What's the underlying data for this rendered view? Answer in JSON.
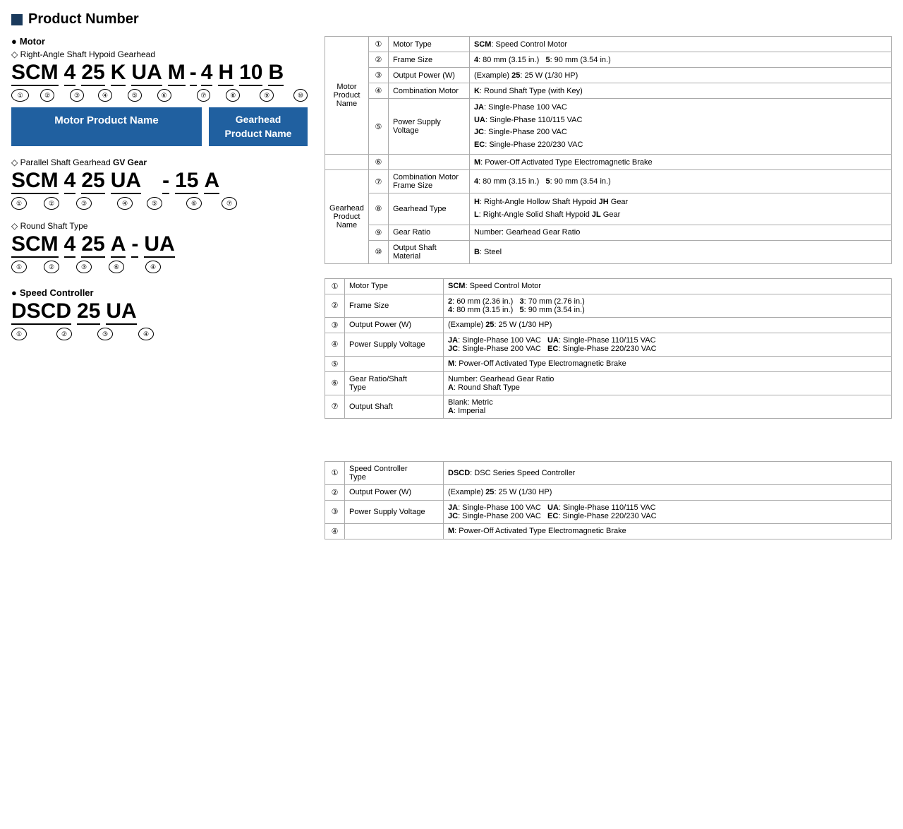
{
  "page": {
    "title": "Product Number",
    "sections": {
      "motor": {
        "label": "Motor",
        "subsections": [
          {
            "type": "diamond",
            "label": "Right-Angle Shaft Hypoid Gearhead",
            "code_parts": [
              "SCM",
              "4",
              "25",
              "K",
              "UA",
              "M",
              "-",
              "4",
              "H",
              "10",
              "B"
            ],
            "nums": [
              "①",
              "②",
              "③",
              "④",
              "⑤",
              "⑥",
              "",
              "⑦",
              "⑧",
              "⑨",
              "⑩"
            ],
            "blue_boxes": [
              "Motor Product Name",
              "Gearhead\nProduct Name"
            ],
            "table_rows": [
              {
                "group": "Motor\nProduct\nName",
                "num": "①",
                "field": "Motor Type",
                "desc": "<b>SCM</b>: Speed Control Motor"
              },
              {
                "group": "",
                "num": "②",
                "field": "Frame Size",
                "desc": "<b>4</b>: 80 mm (3.15 in.)   <b>5</b>: 90 mm (3.54 in.)"
              },
              {
                "group": "",
                "num": "③",
                "field": "Output Power (W)",
                "desc": "(Example) <b>25</b>: 25 W (1/30 HP)"
              },
              {
                "group": "",
                "num": "④",
                "field": "Combination Motor",
                "desc": "<b>K</b>: Round Shaft Type (with Key)"
              },
              {
                "group": "",
                "num": "⑤",
                "field": "Power Supply Voltage",
                "desc": "<b>JA</b>: Single-Phase 100 VAC\n<b>UA</b>: Single-Phase 110/115 VAC\n<b>JC</b>: Single-Phase 200 VAC\n<b>EC</b>: Single-Phase 220/230 VAC"
              },
              {
                "group": "",
                "num": "⑥",
                "field": "",
                "desc": "<b>M</b>: Power-Off Activated Type Electromagnetic Brake"
              },
              {
                "group": "Gearhead\nProduct\nName",
                "num": "⑦",
                "field": "Combination Motor\nFrame Size",
                "desc": "<b>4</b>: 80 mm (3.15 in.)   <b>5</b>: 90 mm (3.54 in.)"
              },
              {
                "group": "",
                "num": "⑧",
                "field": "Gearhead Type",
                "desc": "<b>H</b>: Right-Angle Hollow Shaft Hypoid <b>JH</b> Gear\n<b>L</b>: Right-Angle Solid Shaft Hypoid <b>JL</b> Gear"
              },
              {
                "group": "",
                "num": "⑨",
                "field": "Gear Ratio",
                "desc": "Number: Gearhead Gear Ratio"
              },
              {
                "group": "",
                "num": "⑩",
                "field": "Output Shaft Material",
                "desc": "<b>B</b>: Steel"
              }
            ]
          },
          {
            "type": "diamond",
            "label": "Parallel Shaft Gearhead GV Gear",
            "label_bold": "GV Gear",
            "code_display": "SCM 4 25 UA   - 15 A",
            "nums_display": "① ② ③ ④ ⑤  ⑥ ⑦",
            "table_rows2": [
              {
                "num": "①",
                "field": "Motor Type",
                "desc": "<b>SCM</b>: Speed Control Motor"
              },
              {
                "num": "②",
                "field": "Frame Size",
                "desc": "<b>2</b>: 60 mm (2.36 in.)   <b>3</b>: 70 mm (2.76 in.)\n<b>4</b>: 80 mm (3.15 in.)   <b>5</b>: 90 mm (3.54 in.)"
              },
              {
                "num": "③",
                "field": "Output Power (W)",
                "desc": "(Example) <b>25</b>: 25 W (1/30 HP)"
              },
              {
                "num": "④",
                "field": "Power Supply Voltage",
                "desc": "<b>JA</b>: Single-Phase 100 VAC   <b>UA</b>: Single-Phase 110/115 VAC\n<b>JC</b>: Single-Phase 200 VAC   <b>EC</b>: Single-Phase 220/230 VAC"
              },
              {
                "num": "⑤",
                "field": "",
                "desc": "<b>M</b>: Power-Off Activated Type Electromagnetic Brake"
              },
              {
                "num": "⑥",
                "field": "Gear Ratio/Shaft\nType",
                "desc": "Number: Gearhead Gear Ratio\n<b>A</b>: Round Shaft Type"
              },
              {
                "num": "⑦",
                "field": "Output Shaft",
                "desc": "Blank: Metric\n<b>A</b>: Imperial"
              }
            ]
          },
          {
            "type": "diamond",
            "label": "Round Shaft Type",
            "code_display": "SCM 4 25 A - UA",
            "nums_display": "① ② ③ ⑥  ④"
          }
        ]
      },
      "speed_controller": {
        "label": "Speed Controller",
        "code_display": "DSCD 25 UA",
        "nums_display": "① ② ③ ④",
        "table_rows": [
          {
            "num": "①",
            "field": "Speed Controller\nType",
            "desc": "<b>DSCD</b>: DSC Series Speed Controller"
          },
          {
            "num": "②",
            "field": "Output Power (W)",
            "desc": "(Example) <b>25</b>: 25 W (1/30 HP)"
          },
          {
            "num": "③",
            "field": "Power Supply Voltage",
            "desc": "<b>JA</b>: Single-Phase 100 VAC   <b>UA</b>: Single-Phase 110/115 VAC\n<b>JC</b>: Single-Phase 200 VAC   <b>EC</b>: Single-Phase 220/230 VAC"
          },
          {
            "num": "④",
            "field": "",
            "desc": "<b>M</b>: Power-Off Activated Type Electromagnetic Brake"
          }
        ]
      }
    }
  }
}
